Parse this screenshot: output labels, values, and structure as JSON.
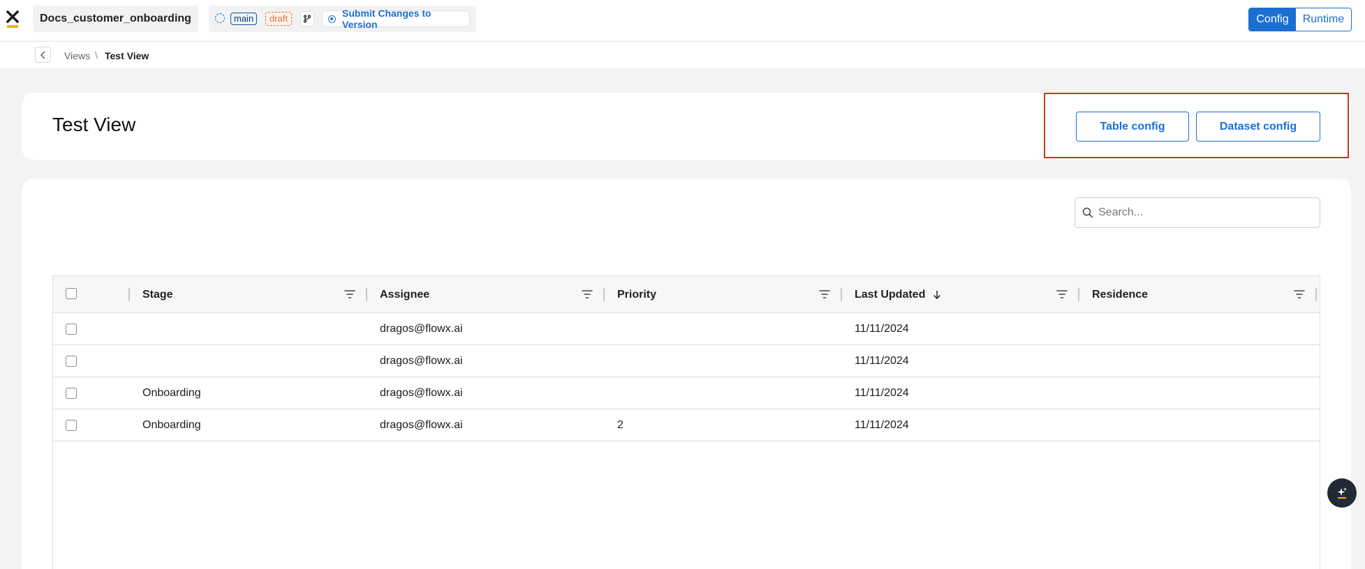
{
  "topbar": {
    "logo": "flowx-logo",
    "project_name": "Docs_customer_onboarding",
    "branch_tag": "main",
    "status_tag": "draft",
    "branch_icon": "git-branch-icon",
    "submit_label": "Submit Changes to Version",
    "mode": {
      "config_label": "Config",
      "runtime_label": "Runtime",
      "active": "Config"
    }
  },
  "breadcrumb": {
    "parent": "Views",
    "separator": "\\",
    "current": "Test View"
  },
  "header": {
    "title": "Test View",
    "table_config_label": "Table config",
    "dataset_config_label": "Dataset config"
  },
  "search": {
    "placeholder": "Search..."
  },
  "table": {
    "columns": [
      {
        "label": "Stage"
      },
      {
        "label": "Assignee"
      },
      {
        "label": "Priority"
      },
      {
        "label": "Last Updated",
        "sort": "desc"
      },
      {
        "label": "Residence"
      }
    ],
    "rows": [
      {
        "stage": "",
        "assignee": "dragos@flowx.ai",
        "priority": "",
        "last_updated": "11/11/2024",
        "residence": ""
      },
      {
        "stage": "",
        "assignee": "dragos@flowx.ai",
        "priority": "",
        "last_updated": "11/11/2024",
        "residence": ""
      },
      {
        "stage": "Onboarding",
        "assignee": "dragos@flowx.ai",
        "priority": "",
        "last_updated": "11/11/2024",
        "residence": ""
      },
      {
        "stage": "Onboarding",
        "assignee": "dragos@flowx.ai",
        "priority": "2",
        "last_updated": "11/11/2024",
        "residence": ""
      }
    ]
  },
  "colors": {
    "accent": "#1b6fd1",
    "draft": "#e86a3a",
    "highlight": "#c23b22",
    "logo_bar": "#f2b400"
  }
}
